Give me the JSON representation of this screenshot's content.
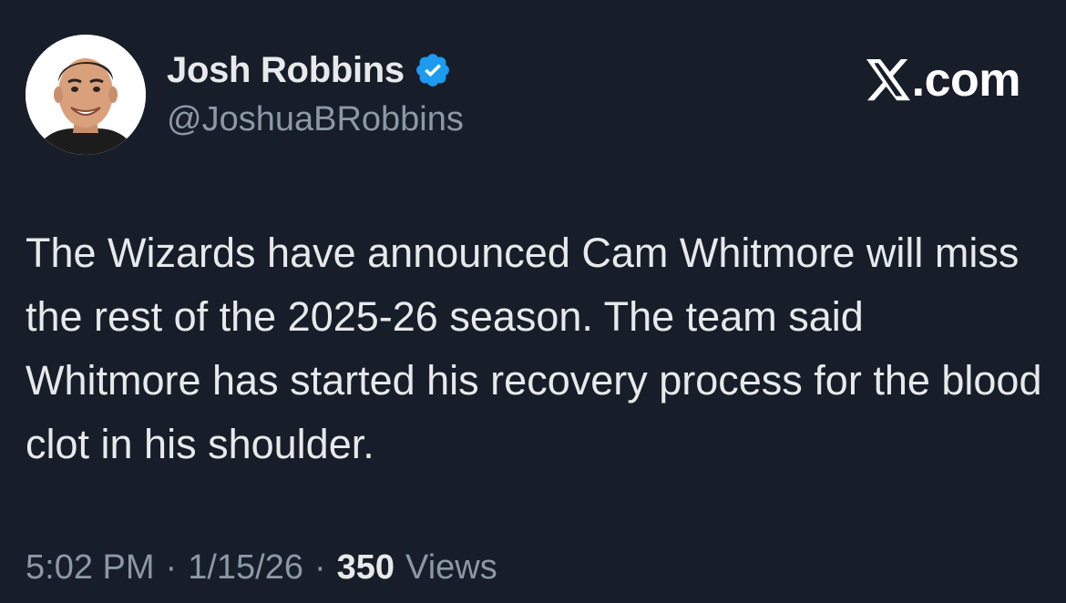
{
  "author": {
    "display_name": "Josh Robbins",
    "handle": "@JoshuaBRobbins",
    "verified": true,
    "avatar_icon": "profile-photo"
  },
  "brand": {
    "icon": "x-logo-icon",
    "text": ".com"
  },
  "tweet": {
    "text": "The Wizards have announced Cam Whitmore will miss the rest of the 2025-26 season. The team said Whitmore has started his recovery process for the blood clot in his shoulder."
  },
  "meta": {
    "time": "5:02 PM",
    "separator": "·",
    "date": "1/15/26",
    "views_count": "350",
    "views_label": "Views"
  },
  "colors": {
    "background": "#171e29",
    "primary_text": "#e7e9ea",
    "secondary_text": "#8b98a5",
    "verified_blue": "#1d9bf0"
  }
}
